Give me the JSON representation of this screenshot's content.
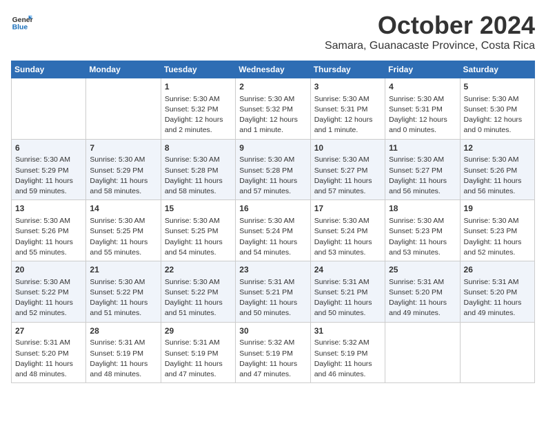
{
  "logo": {
    "general": "General",
    "blue": "Blue"
  },
  "title": {
    "month": "October 2024",
    "location": "Samara, Guanacaste Province, Costa Rica"
  },
  "headers": [
    "Sunday",
    "Monday",
    "Tuesday",
    "Wednesday",
    "Thursday",
    "Friday",
    "Saturday"
  ],
  "weeks": [
    [
      {
        "day": "",
        "info": ""
      },
      {
        "day": "",
        "info": ""
      },
      {
        "day": "1",
        "info": "Sunrise: 5:30 AM\nSunset: 5:32 PM\nDaylight: 12 hours\nand 2 minutes."
      },
      {
        "day": "2",
        "info": "Sunrise: 5:30 AM\nSunset: 5:32 PM\nDaylight: 12 hours\nand 1 minute."
      },
      {
        "day": "3",
        "info": "Sunrise: 5:30 AM\nSunset: 5:31 PM\nDaylight: 12 hours\nand 1 minute."
      },
      {
        "day": "4",
        "info": "Sunrise: 5:30 AM\nSunset: 5:31 PM\nDaylight: 12 hours\nand 0 minutes."
      },
      {
        "day": "5",
        "info": "Sunrise: 5:30 AM\nSunset: 5:30 PM\nDaylight: 12 hours\nand 0 minutes."
      }
    ],
    [
      {
        "day": "6",
        "info": "Sunrise: 5:30 AM\nSunset: 5:29 PM\nDaylight: 11 hours\nand 59 minutes."
      },
      {
        "day": "7",
        "info": "Sunrise: 5:30 AM\nSunset: 5:29 PM\nDaylight: 11 hours\nand 58 minutes."
      },
      {
        "day": "8",
        "info": "Sunrise: 5:30 AM\nSunset: 5:28 PM\nDaylight: 11 hours\nand 58 minutes."
      },
      {
        "day": "9",
        "info": "Sunrise: 5:30 AM\nSunset: 5:28 PM\nDaylight: 11 hours\nand 57 minutes."
      },
      {
        "day": "10",
        "info": "Sunrise: 5:30 AM\nSunset: 5:27 PM\nDaylight: 11 hours\nand 57 minutes."
      },
      {
        "day": "11",
        "info": "Sunrise: 5:30 AM\nSunset: 5:27 PM\nDaylight: 11 hours\nand 56 minutes."
      },
      {
        "day": "12",
        "info": "Sunrise: 5:30 AM\nSunset: 5:26 PM\nDaylight: 11 hours\nand 56 minutes."
      }
    ],
    [
      {
        "day": "13",
        "info": "Sunrise: 5:30 AM\nSunset: 5:26 PM\nDaylight: 11 hours\nand 55 minutes."
      },
      {
        "day": "14",
        "info": "Sunrise: 5:30 AM\nSunset: 5:25 PM\nDaylight: 11 hours\nand 55 minutes."
      },
      {
        "day": "15",
        "info": "Sunrise: 5:30 AM\nSunset: 5:25 PM\nDaylight: 11 hours\nand 54 minutes."
      },
      {
        "day": "16",
        "info": "Sunrise: 5:30 AM\nSunset: 5:24 PM\nDaylight: 11 hours\nand 54 minutes."
      },
      {
        "day": "17",
        "info": "Sunrise: 5:30 AM\nSunset: 5:24 PM\nDaylight: 11 hours\nand 53 minutes."
      },
      {
        "day": "18",
        "info": "Sunrise: 5:30 AM\nSunset: 5:23 PM\nDaylight: 11 hours\nand 53 minutes."
      },
      {
        "day": "19",
        "info": "Sunrise: 5:30 AM\nSunset: 5:23 PM\nDaylight: 11 hours\nand 52 minutes."
      }
    ],
    [
      {
        "day": "20",
        "info": "Sunrise: 5:30 AM\nSunset: 5:22 PM\nDaylight: 11 hours\nand 52 minutes."
      },
      {
        "day": "21",
        "info": "Sunrise: 5:30 AM\nSunset: 5:22 PM\nDaylight: 11 hours\nand 51 minutes."
      },
      {
        "day": "22",
        "info": "Sunrise: 5:30 AM\nSunset: 5:22 PM\nDaylight: 11 hours\nand 51 minutes."
      },
      {
        "day": "23",
        "info": "Sunrise: 5:31 AM\nSunset: 5:21 PM\nDaylight: 11 hours\nand 50 minutes."
      },
      {
        "day": "24",
        "info": "Sunrise: 5:31 AM\nSunset: 5:21 PM\nDaylight: 11 hours\nand 50 minutes."
      },
      {
        "day": "25",
        "info": "Sunrise: 5:31 AM\nSunset: 5:20 PM\nDaylight: 11 hours\nand 49 minutes."
      },
      {
        "day": "26",
        "info": "Sunrise: 5:31 AM\nSunset: 5:20 PM\nDaylight: 11 hours\nand 49 minutes."
      }
    ],
    [
      {
        "day": "27",
        "info": "Sunrise: 5:31 AM\nSunset: 5:20 PM\nDaylight: 11 hours\nand 48 minutes."
      },
      {
        "day": "28",
        "info": "Sunrise: 5:31 AM\nSunset: 5:19 PM\nDaylight: 11 hours\nand 48 minutes."
      },
      {
        "day": "29",
        "info": "Sunrise: 5:31 AM\nSunset: 5:19 PM\nDaylight: 11 hours\nand 47 minutes."
      },
      {
        "day": "30",
        "info": "Sunrise: 5:32 AM\nSunset: 5:19 PM\nDaylight: 11 hours\nand 47 minutes."
      },
      {
        "day": "31",
        "info": "Sunrise: 5:32 AM\nSunset: 5:19 PM\nDaylight: 11 hours\nand 46 minutes."
      },
      {
        "day": "",
        "info": ""
      },
      {
        "day": "",
        "info": ""
      }
    ]
  ]
}
